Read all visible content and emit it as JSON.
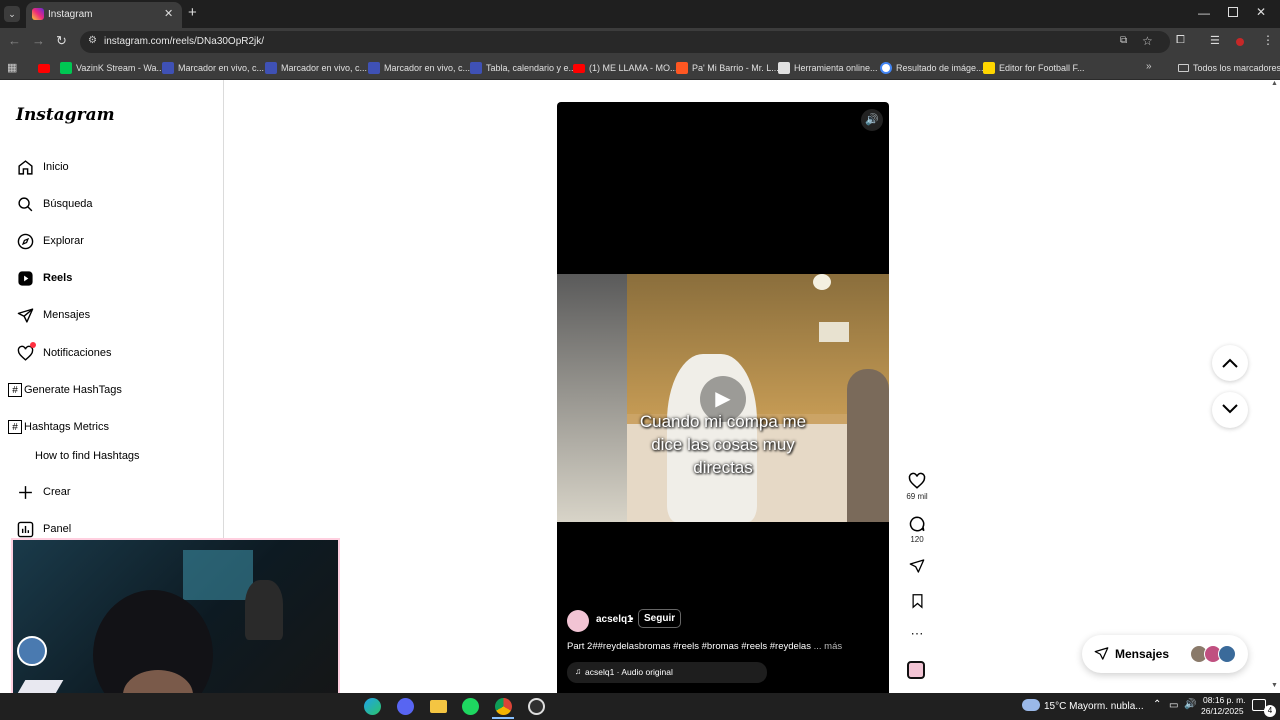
{
  "browser": {
    "tab_title": "Instagram",
    "url": "instagram.com/reels/DNa30OpR2jk/",
    "bookmarks": [
      {
        "label": "VazinK Stream - Wa...",
        "color": "#00c853"
      },
      {
        "label": "Marcador en vivo, c...",
        "color": "#3f51b5"
      },
      {
        "label": "Marcador en vivo, c...",
        "color": "#3f51b5"
      },
      {
        "label": "Marcador en vivo, c...",
        "color": "#3f51b5"
      },
      {
        "label": "Tabla, calendario y e...",
        "color": "#3f51b5"
      },
      {
        "label": "(1) ME LLAMA - MO...",
        "color": "#ff0000"
      },
      {
        "label": "Pa' Mi Barrio - Mr. L...",
        "color": "#ff5722"
      },
      {
        "label": "Herramienta online...",
        "color": "#e0e0e0"
      },
      {
        "label": "Resultado de imáge...",
        "color": "#4285f4"
      },
      {
        "label": "Editor for Football F...",
        "color": "#ffd600"
      }
    ],
    "all_bookmarks": "Todos los marcadores"
  },
  "sidebar": {
    "logo": "Instagram",
    "items": [
      {
        "label": "Inicio",
        "icon": "home-icon"
      },
      {
        "label": "Búsqueda",
        "icon": "search-icon"
      },
      {
        "label": "Explorar",
        "icon": "compass-icon"
      },
      {
        "label": "Reels",
        "icon": "reels-icon"
      },
      {
        "label": "Mensajes",
        "icon": "send-icon"
      },
      {
        "label": "Notificaciones",
        "icon": "heart-icon"
      },
      {
        "label": "Generate HashTags",
        "icon": "hashtag-icon"
      },
      {
        "label": "Hashtags Metrics",
        "icon": "hashtag-icon"
      },
      {
        "label": "How to find Hashtags",
        "icon": ""
      },
      {
        "label": "Crear",
        "icon": "plus-icon"
      },
      {
        "label": "Panel",
        "icon": "chart-icon"
      }
    ]
  },
  "reel": {
    "caption_lines": [
      "Cuando mi compa me",
      "dice las cosas muy",
      "directas"
    ],
    "username": "acselq1",
    "follow_label": "Seguir",
    "description": "Part 2##reydelasbromas #reels #bromas #reels #reydelas",
    "more_label": "... más",
    "audio": "acselq1 · Audio original",
    "likes": "69 mil",
    "comments": "120"
  },
  "messages_button": "Mensajes",
  "taskbar": {
    "weather": "15°C  Mayorm. nubla...",
    "time": "08:16 p. m.",
    "date": "26/12/2025",
    "notifications": "4"
  }
}
